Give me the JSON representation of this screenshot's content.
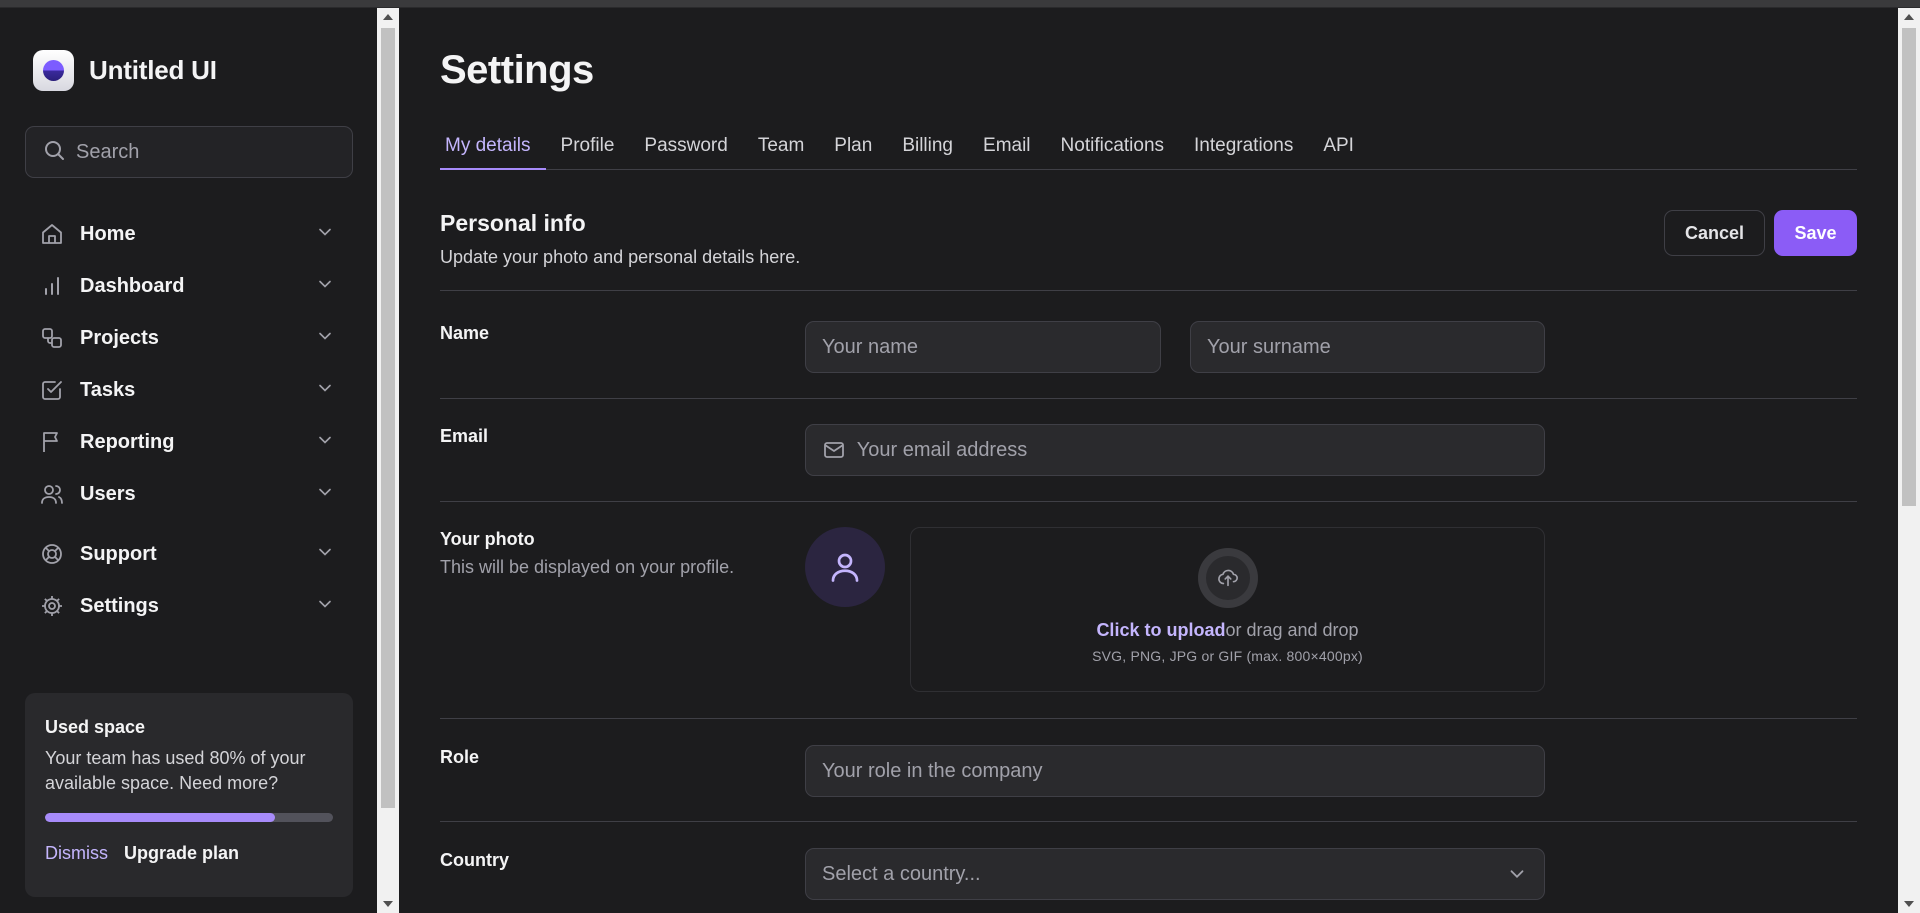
{
  "brand": {
    "name": "Untitled UI"
  },
  "search": {
    "placeholder": "Search"
  },
  "nav": {
    "primary": [
      {
        "label": "Home",
        "icon": "home-icon"
      },
      {
        "label": "Dashboard",
        "icon": "bar-chart-icon"
      },
      {
        "label": "Projects",
        "icon": "projects-icon"
      },
      {
        "label": "Tasks",
        "icon": "check-square-icon"
      },
      {
        "label": "Reporting",
        "icon": "flag-icon"
      },
      {
        "label": "Users",
        "icon": "users-icon"
      }
    ],
    "secondary": [
      {
        "label": "Support",
        "icon": "life-buoy-icon"
      },
      {
        "label": "Settings",
        "icon": "gear-icon"
      }
    ]
  },
  "space_card": {
    "title": "Used space",
    "text": "Your team has used 80% of your available space. Need more?",
    "progress_fraction": 0.8,
    "dismiss_label": "Dismiss",
    "upgrade_label": "Upgrade plan"
  },
  "page": {
    "title": "Settings"
  },
  "tabs": [
    {
      "label": "My details",
      "active": true
    },
    {
      "label": "Profile"
    },
    {
      "label": "Password"
    },
    {
      "label": "Team"
    },
    {
      "label": "Plan"
    },
    {
      "label": "Billing"
    },
    {
      "label": "Email"
    },
    {
      "label": "Notifications"
    },
    {
      "label": "Integrations"
    },
    {
      "label": "API"
    }
  ],
  "personal_info": {
    "title": "Personal info",
    "subtitle": "Update your photo and personal details here.",
    "cancel_label": "Cancel",
    "save_label": "Save"
  },
  "form": {
    "name": {
      "label": "Name",
      "first_placeholder": "Your name",
      "last_placeholder": "Your surname"
    },
    "email": {
      "label": "Email",
      "placeholder": "Your email address"
    },
    "photo": {
      "label": "Your photo",
      "sublabel": "This will be displayed on your profile.",
      "upload_link": "Click to upload",
      "upload_text": "or drag and drop",
      "upload_hint": "SVG, PNG, JPG or GIF (max. 800×400px)"
    },
    "role": {
      "label": "Role",
      "placeholder": "Your role in the company"
    },
    "country": {
      "label": "Country",
      "placeholder": "Select a country..."
    }
  },
  "colors": {
    "accent": "#8b5cf6",
    "accent_light": "#c4b5fd",
    "background": "#1c1c1e",
    "border": "#3f3f46"
  }
}
